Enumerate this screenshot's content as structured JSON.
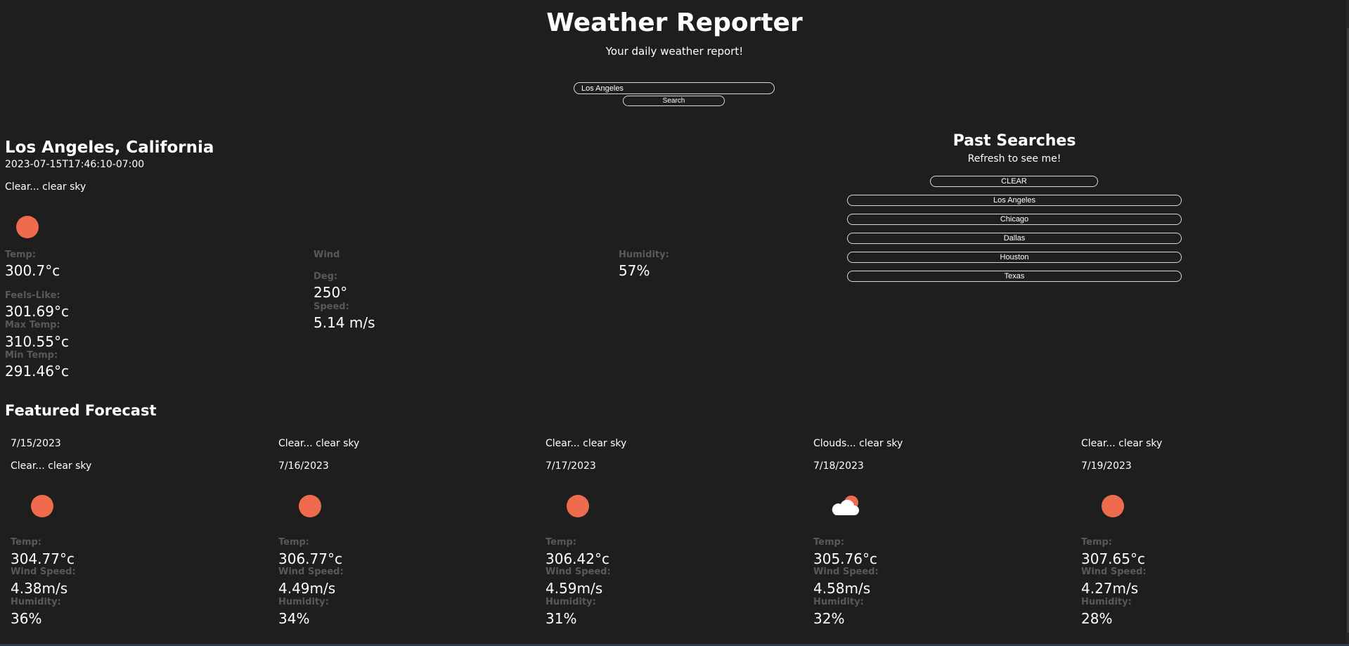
{
  "header": {
    "title": "Weather Reporter",
    "subtitle": "Your daily weather report!"
  },
  "search": {
    "value": "Los Angeles",
    "button_label": "Search"
  },
  "current": {
    "city": "Los Angeles, California",
    "datetime": "2023-07-15T17:46:10-07:00",
    "description": "Clear... clear sky",
    "icon": "sun-icon",
    "temp_label": "Temp:",
    "temp": "300.7°c",
    "feels_like_label": "Feels-Like:",
    "feels_like": "301.69°c",
    "max_temp_label": "Max Temp:",
    "max_temp": "310.55°c",
    "min_temp_label": "Min Temp:",
    "min_temp": "291.46°c",
    "wind_label": "Wind",
    "deg_label": "Deg:",
    "deg": "250°",
    "speed_label": "Speed:",
    "speed": "5.14 m/s",
    "humidity_label": "Humidity:",
    "humidity": "57%"
  },
  "past_searches": {
    "title": "Past Searches",
    "subtitle": "Refresh to see me!",
    "clear_label": "CLEAR",
    "items": [
      "Los Angeles",
      "Chicago",
      "Dallas",
      "Houston",
      "Texas"
    ]
  },
  "forecast": {
    "title": "Featured Forecast",
    "temp_label": "Temp:",
    "wind_label": "Wind Speed:",
    "humidity_label": "Humidity:",
    "days": [
      {
        "date": "7/15/2023",
        "description": "Clear... clear sky",
        "icon": "sun-icon",
        "temp": "304.77°c",
        "wind": "4.38m/s",
        "humidity": "36%"
      },
      {
        "date": "7/16/2023",
        "description": "Clear... clear sky",
        "icon": "sun-icon",
        "temp": "306.77°c",
        "wind": "4.49m/s",
        "humidity": "34%"
      },
      {
        "date": "7/17/2023",
        "description": "Clear... clear sky",
        "icon": "sun-icon",
        "temp": "306.42°c",
        "wind": "4.59m/s",
        "humidity": "31%"
      },
      {
        "date": "7/18/2023",
        "description": "Clouds... clear sky",
        "icon": "cloud-sun-icon",
        "temp": "305.76°c",
        "wind": "4.58m/s",
        "humidity": "32%"
      },
      {
        "date": "7/19/2023",
        "description": "Clear... clear sky",
        "icon": "sun-icon",
        "temp": "307.65°c",
        "wind": "4.27m/s",
        "humidity": "28%"
      }
    ]
  },
  "colors": {
    "background": "#1e1e1e",
    "accent_sun": "#ee6c4d",
    "label_gray": "#595959"
  }
}
